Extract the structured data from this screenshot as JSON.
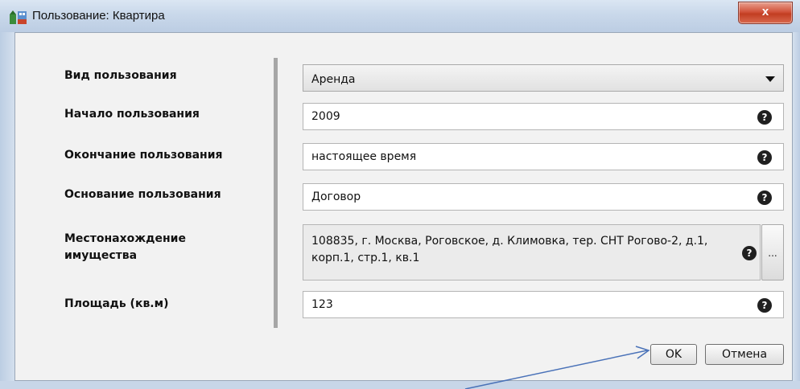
{
  "window": {
    "title": "Пользование: Квартира",
    "close_label": "x"
  },
  "form": {
    "usage_type": {
      "label": "Вид пользования",
      "value": "Аренда"
    },
    "start": {
      "label": "Начало пользования",
      "value": "2009"
    },
    "end": {
      "label": "Окончание пользования",
      "value": "настоящее время"
    },
    "basis": {
      "label": "Основание пользования",
      "value": "Договор"
    },
    "location": {
      "label": "Местонахождение имущества",
      "value": "108835, г. Москва, Роговское, д. Климовка, тер. СНТ Рогово-2, д.1, корп.1, стр.1, кв.1"
    },
    "area": {
      "label": "Площадь (кв.м)",
      "value": "123"
    },
    "help_symbol": "?",
    "browse_label": "..."
  },
  "buttons": {
    "ok": "OK",
    "cancel": "Отмена"
  },
  "colors": {
    "close_button": "#c9442a",
    "annotation_arrow": "#4a72b8"
  },
  "icons": [
    "app-icon",
    "help-icon",
    "dropdown-arrow-icon",
    "annotation-arrow"
  ]
}
